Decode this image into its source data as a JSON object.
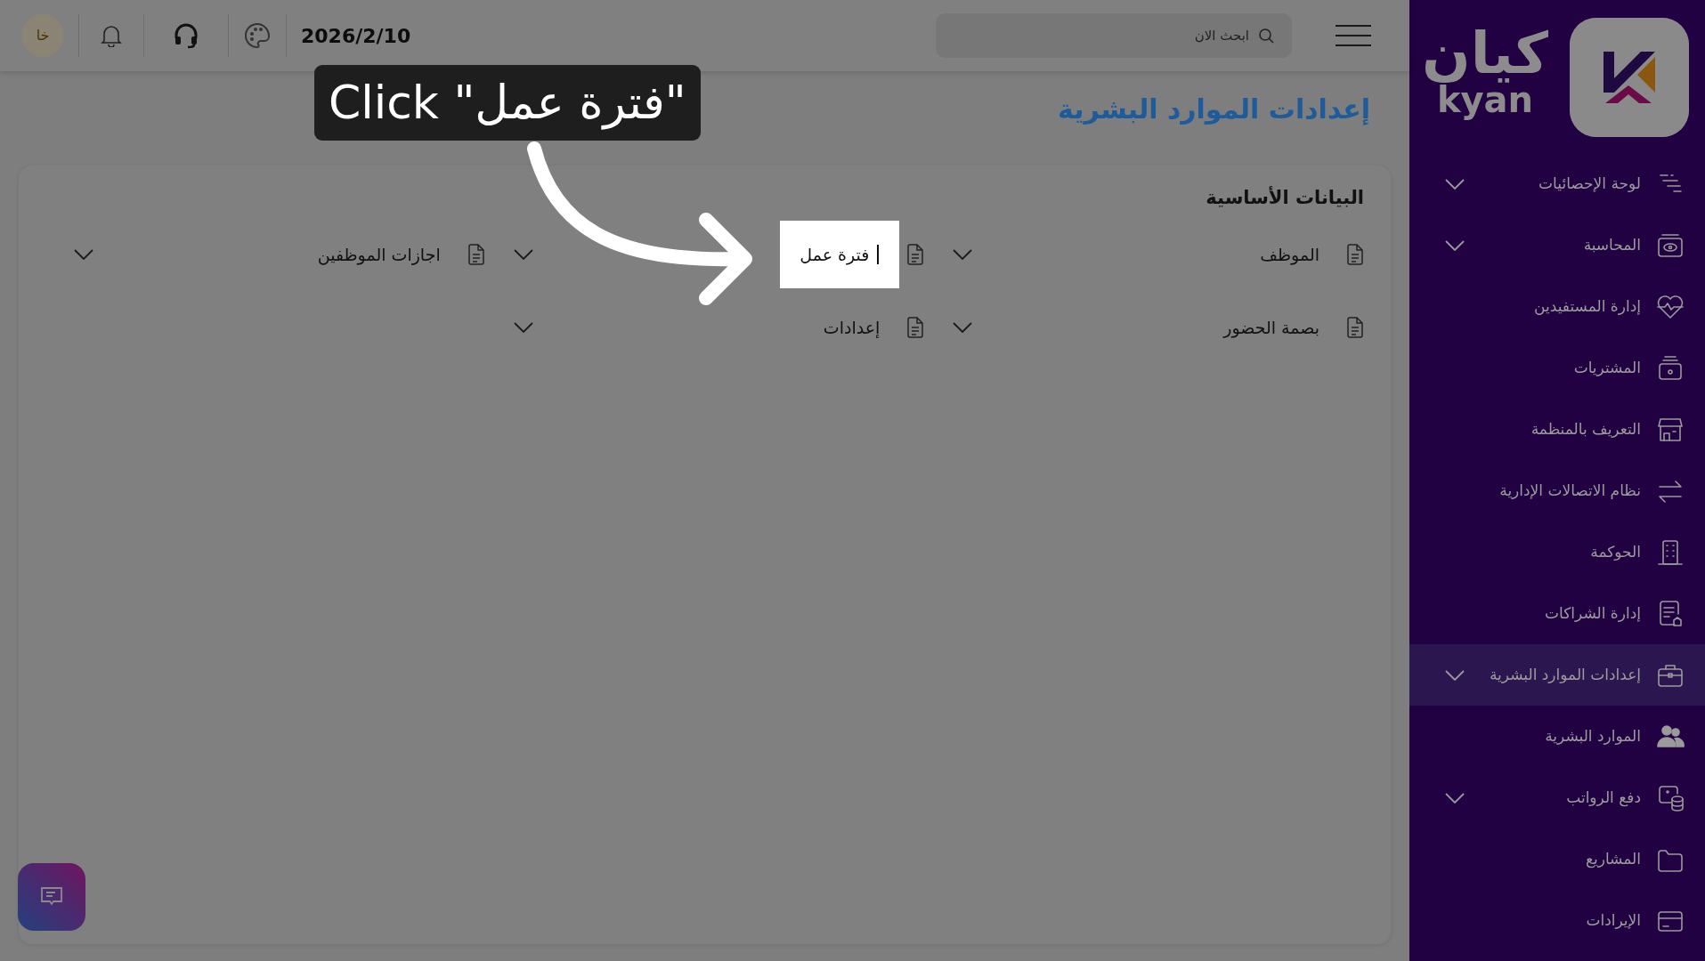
{
  "topbar": {
    "avatar": "خا",
    "date": "2026/2/10",
    "search": {
      "placeholder": "ابحث الان"
    }
  },
  "sidebar": {
    "logo": {
      "arabic": "كيان",
      "latin": "kyan"
    },
    "items": [
      {
        "label": "لوحة الإحصائيات",
        "expandable": true,
        "selected": false
      },
      {
        "label": "المحاسبة",
        "expandable": true,
        "selected": false
      },
      {
        "label": "إدارة المستفيدين",
        "expandable": false,
        "selected": false
      },
      {
        "label": "المشتريات",
        "expandable": false,
        "selected": false
      },
      {
        "label": "التعريف بالمنظمة",
        "expandable": false,
        "selected": false
      },
      {
        "label": "نظام الاتصالات الإدارية",
        "expandable": false,
        "selected": false
      },
      {
        "label": "الحوكمة",
        "expandable": false,
        "selected": false
      },
      {
        "label": "إدارة الشراكات",
        "expandable": false,
        "selected": false
      },
      {
        "label": "إعدادات الموارد البشرية",
        "expandable": true,
        "selected": true
      },
      {
        "label": "الموارد البشرية",
        "expandable": false,
        "selected": false
      },
      {
        "label": "دفع الرواتب",
        "expandable": true,
        "selected": false
      },
      {
        "label": "المشاريع",
        "expandable": false,
        "selected": false
      },
      {
        "label": "الإيرادات",
        "expandable": false,
        "selected": false
      }
    ]
  },
  "page": {
    "title": "إعدادات الموارد البشرية"
  },
  "card": {
    "title": "البيانات الأساسية",
    "items": [
      {
        "label": "الموظف",
        "highlighted": false
      },
      {
        "label": "فترة عمل",
        "highlighted": true
      },
      {
        "label": "اجازات الموظفين",
        "highlighted": false
      },
      {
        "label": "بصمة الحضور",
        "highlighted": false
      },
      {
        "label": "إعدادات",
        "highlighted": false
      }
    ]
  },
  "tutorial": {
    "callout": "Click \"فترة عمل\""
  }
}
